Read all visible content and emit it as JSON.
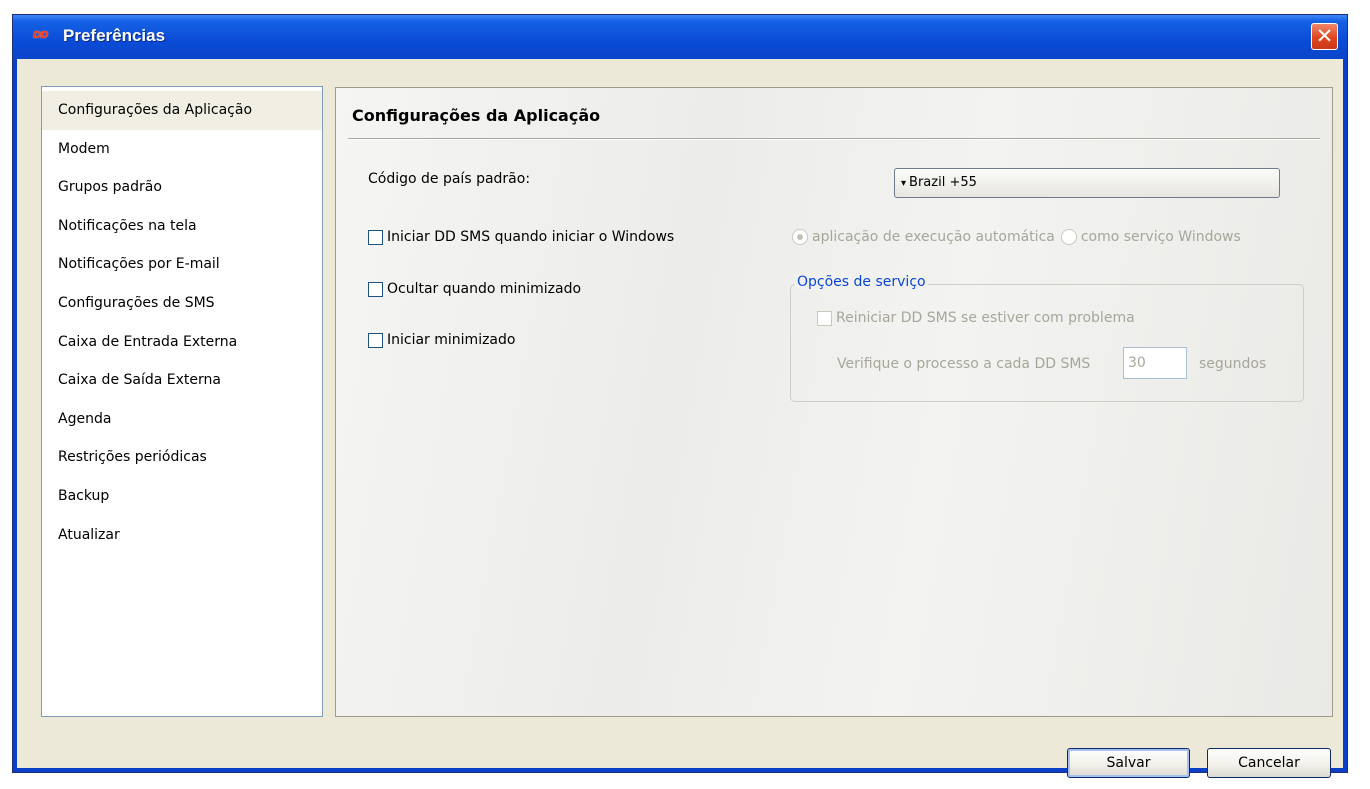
{
  "window": {
    "title": "Preferências",
    "logo_text": "DD",
    "close_glyph": "✕"
  },
  "sidebar": {
    "items": [
      {
        "label": "Configurações da Aplicação",
        "selected": true
      },
      {
        "label": "Modem"
      },
      {
        "label": "Grupos padrão"
      },
      {
        "label": "Notificações na tela"
      },
      {
        "label": "Notificações por E-mail"
      },
      {
        "label": "Configurações de SMS"
      },
      {
        "label": "Caixa de Entrada Externa"
      },
      {
        "label": "Caixa de Saída Externa"
      },
      {
        "label": "Agenda"
      },
      {
        "label": "Restrições periódicas"
      },
      {
        "label": "Backup"
      },
      {
        "label": "Atualizar"
      }
    ]
  },
  "content": {
    "title": "Configurações da Aplicação",
    "country_label": "Código de país padrão:",
    "country_value": "Brazil +55",
    "caret": "▾",
    "start_with_windows": {
      "label": "Iniciar DD SMS quando iniciar o Windows",
      "checked": false
    },
    "hide_minimized": {
      "label": "Ocultar quando minimizado",
      "checked": false
    },
    "start_minimized": {
      "label": "Iniciar minimizado",
      "checked": false
    },
    "run_mode": {
      "auto_label": "aplicação de execução automática",
      "service_label": "como serviço Windows",
      "selected": "auto"
    },
    "service_options": {
      "legend": "Opções de serviço",
      "restart_label": "Reiniciar DD SMS se estiver com problema",
      "interval_label": "Verifique o processo a cada DD SMS",
      "interval_value": "30",
      "seconds_label": "segundos"
    }
  },
  "buttons": {
    "save": "Salvar",
    "cancel": "Cancelar"
  },
  "colors": {
    "titlebar": "#0a4bd6",
    "legend_blue": "#0a46d6",
    "disabled_text": "#a7a699"
  }
}
